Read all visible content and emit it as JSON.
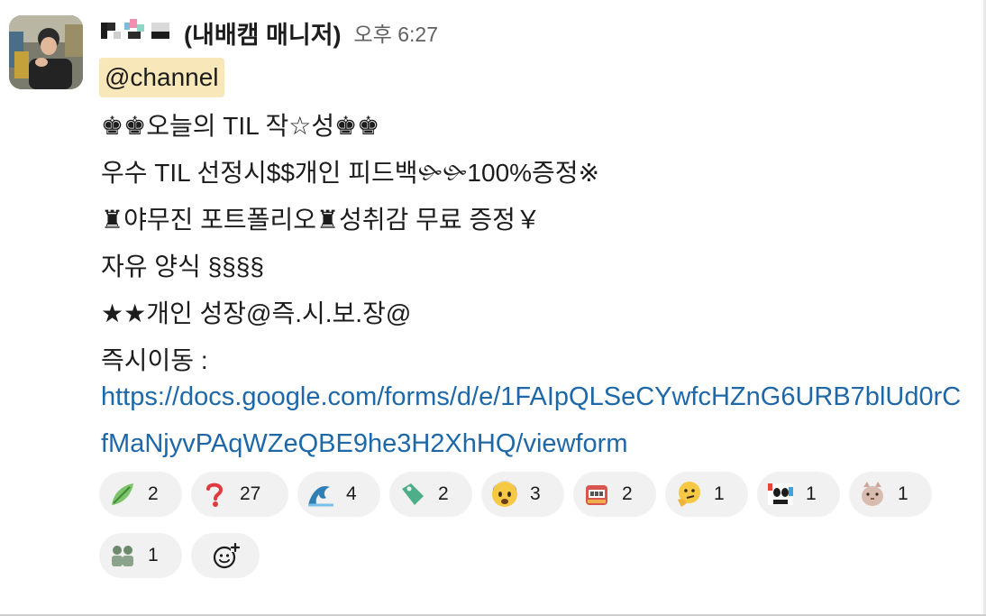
{
  "message": {
    "author": "(내배캠 매니저)",
    "time": "오후 6:27",
    "mention": "@channel",
    "lines": [
      "♚♚오늘의 TIL 작☆성♚♚",
      "우수 TIL 선정시$$개인 피드백🙛🙛100%증정※",
      "♜야무진 포트폴리오♜성취감 무료 증정￥",
      "자유 양식 §§§§",
      "★★개인 성장@즉.시.보.장@",
      "즉시이동 :"
    ],
    "link": "https://docs.google.com/forms/d/e/1FAIpQLSeCYwfcHZnG6URB7blUd0rCfMaNjyvPAqWZeQBE9he3H2XhHQ/viewform"
  },
  "reactions": [
    {
      "icon": "green-leaf-emoji",
      "count": "2"
    },
    {
      "icon": "red-question-mark-emoji",
      "count": "27"
    },
    {
      "icon": "wave-emoji",
      "count": "4"
    },
    {
      "icon": "green-tag-emoji",
      "count": "2"
    },
    {
      "icon": "fearful-face-emoji",
      "count": "3"
    },
    {
      "icon": "slot-machine-emoji",
      "count": "2"
    },
    {
      "icon": "thinking-face-emoji",
      "count": "1"
    },
    {
      "icon": "panda-emoji",
      "count": "1"
    },
    {
      "icon": "cat-emoji",
      "count": "1"
    },
    {
      "icon": "people-emoji",
      "count": "1"
    }
  ],
  "add_reaction_icon": "add-reaction-icon",
  "colors": {
    "link": "#1e68a8",
    "mention_bg": "#f8e7b8",
    "reaction_bg": "#f1f1f1",
    "timestamp": "#616061"
  }
}
